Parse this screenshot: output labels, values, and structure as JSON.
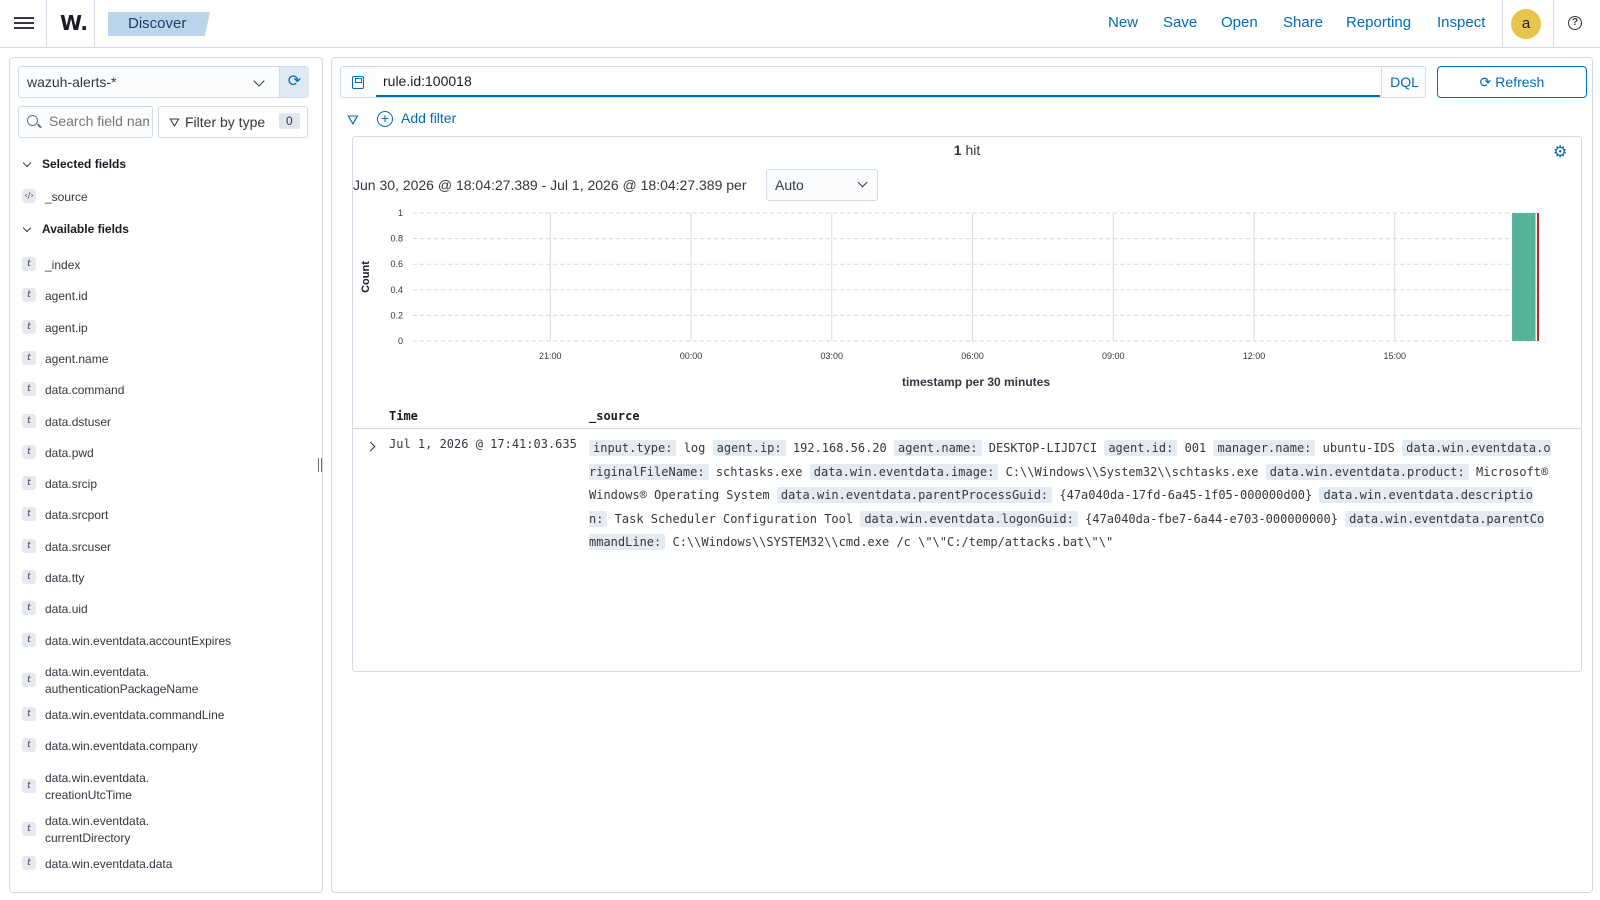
{
  "topbar": {
    "logo": "W.",
    "breadcrumb": "Discover",
    "nav": [
      "New",
      "Save",
      "Open",
      "Share",
      "Reporting",
      "Inspect"
    ],
    "avatar": "a",
    "help": "?"
  },
  "sidebar": {
    "index_pattern": "wazuh-alerts-*",
    "search_placeholder": "Search field names",
    "filter_by_type_label": "Filter by type",
    "filter_count": "0",
    "selected_fields_title": "Selected fields",
    "selected_fields": [
      "_source"
    ],
    "available_fields_title": "Available fields",
    "available_fields": [
      "_index",
      "agent.id",
      "agent.ip",
      "agent.name",
      "data.command",
      "data.dstuser",
      "data.pwd",
      "data.srcip",
      "data.srcport",
      "data.srcuser",
      "data.tty",
      "data.uid",
      "data.win.eventdata.accountExpires",
      "data.win.eventdata.\nauthenticationPackageName",
      "data.win.eventdata.commandLine",
      "data.win.eventdata.company",
      "data.win.eventdata.\ncreationUtcTime",
      "data.win.eventdata.\ncurrentDirectory",
      "data.win.eventdata.data"
    ]
  },
  "query": {
    "value": "rule.id:100018",
    "language": "DQL",
    "refresh_label": "Refresh",
    "add_filter_label": "Add filter"
  },
  "results": {
    "hit_count": "1",
    "hit_label": "hit",
    "time_range": "Jun 30, 2026 @ 18:04:27.389 - Jul 1, 2026 @ 18:04:27.389 per",
    "interval": "Auto",
    "columns": [
      "Time",
      "_source"
    ],
    "rows": [
      {
        "time": "Jul 1, 2026 @ 17:41:03.635",
        "source": [
          {
            "k": "input.type:",
            "v": "log"
          },
          {
            "k": "agent.ip:",
            "v": "192.168.56.20"
          },
          {
            "k": "agent.name:",
            "v": "DESKTOP-LIJD7CI"
          },
          {
            "k": "agent.id:",
            "v": "001"
          },
          {
            "k": "manager.name:",
            "v": "ubuntu-IDS"
          },
          {
            "k": "data.win.eventdata.originalFileName:",
            "v": "schtasks.exe"
          },
          {
            "k": "data.win.eventdata.image:",
            "v": "C:\\\\Windows\\\\System32\\\\schtasks.exe"
          },
          {
            "k": "data.win.eventdata.product:",
            "v": "Microsoft® Windows® Operating System"
          },
          {
            "k": "data.win.eventdata.parentProcessGuid:",
            "v": "{47a040da-17fd-6a45-1f05-000000d00}"
          },
          {
            "k": "data.win.eventdata.description:",
            "v": "Task Scheduler Configuration Tool"
          },
          {
            "k": "data.win.eventdata.logonGuid:",
            "v": "{47a040da-fbe7-6a44-e703-000000000}"
          },
          {
            "k": "data.win.eventdata.parentCommandLine:",
            "v": "C:\\\\Windows\\\\SYSTEM32\\\\cmd.exe /c \\\"\\\"C:/temp/attacks.bat\\\"\\\""
          }
        ]
      }
    ]
  },
  "chart_data": {
    "type": "bar",
    "x_ticks": [
      "21:00",
      "00:00",
      "03:00",
      "06:00",
      "09:00",
      "12:00",
      "15:00"
    ],
    "y_ticks": [
      "0",
      "0.2",
      "0.4",
      "0.6",
      "0.8",
      "1"
    ],
    "ylim": [
      0,
      1
    ],
    "ylabel": "Count",
    "xlabel": "timestamp per 30 minutes",
    "bars": [
      {
        "bucket": "17:30",
        "value": 1
      }
    ],
    "bar_color": "#54b399",
    "now_marker_color": "#bd271e",
    "grid": true
  }
}
